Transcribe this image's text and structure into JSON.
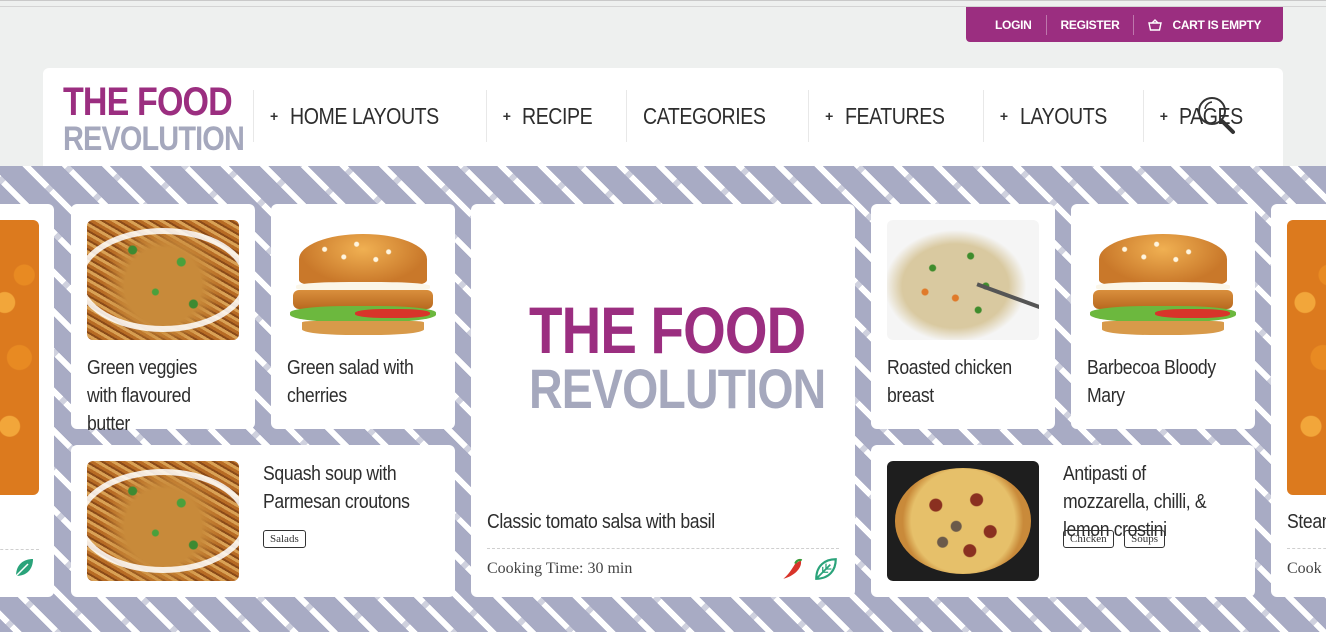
{
  "topbar": {
    "login": "LOGIN",
    "register": "REGISTER",
    "cart": "CART IS EMPTY",
    "color": "#9b2e80"
  },
  "logo": {
    "line1": "THE FOOD",
    "line2": "REVOLUTION"
  },
  "nav": {
    "items": [
      {
        "label": "HOME LAYOUTS",
        "has_plus": true
      },
      {
        "label": "RECIPE",
        "has_plus": true
      },
      {
        "label": "CATEGORIES",
        "has_plus": false
      },
      {
        "label": "FEATURES",
        "has_plus": true
      },
      {
        "label": "LAYOUTS",
        "has_plus": true
      },
      {
        "label": "PAGES",
        "has_plus": true
      }
    ],
    "plus": "+",
    "search_icon": "search-icon"
  },
  "featured": {
    "logo_line1": "THE FOOD",
    "logo_line2": "REVOLUTION",
    "title": "Classic tomato salsa with basil",
    "cooking_time": "Cooking Time: 30 min",
    "icons": [
      "chili-icon",
      "leaf-icon"
    ]
  },
  "cards": {
    "green_veggies": {
      "title": "Green veggies with flavoured butter"
    },
    "green_salad": {
      "title": "Green salad with cherries"
    },
    "squash_soup": {
      "title": "Squash soup with Parmesan croutons",
      "tags": [
        "Salads"
      ]
    },
    "roasted_chicken": {
      "title": "Roasted chicken breast"
    },
    "barbecoa": {
      "title": "Barbecoa Bloody Mary"
    },
    "antipasti": {
      "title": "Antipasti of mozzarella, chilli, & lemon crostini",
      "tags": [
        "Chicken",
        "Soups"
      ]
    },
    "right_partial": {
      "title": "Stean",
      "cooking_time": "Cook"
    }
  },
  "colors": {
    "accent": "#9b2e80",
    "muted": "#a5a8bd",
    "pattern": "#a8abc4"
  }
}
